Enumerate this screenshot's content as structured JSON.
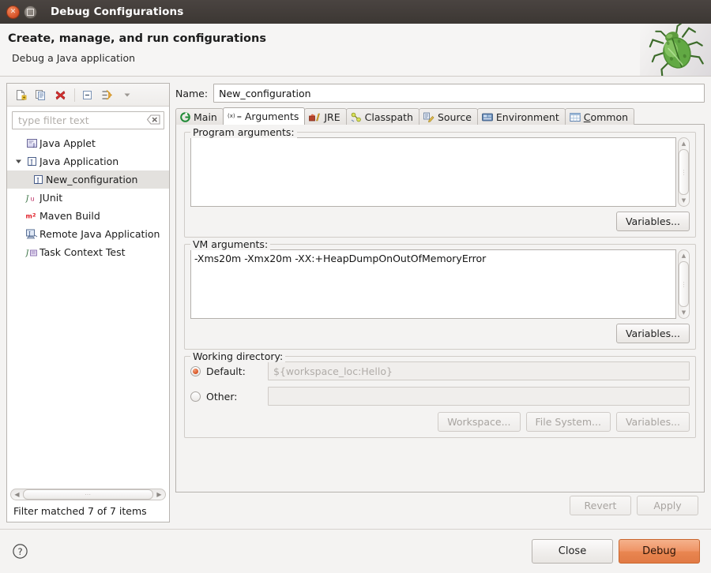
{
  "window": {
    "title": "Debug Configurations",
    "close_icon": "close-icon",
    "maximize_icon": "maximize-icon"
  },
  "header": {
    "title": "Create, manage, and run configurations",
    "subtitle": "Debug a Java application",
    "decoration_icon": "bug-icon"
  },
  "sidebar": {
    "toolbar": [
      {
        "name": "new-configuration-button",
        "icon": "new-document-icon",
        "label": "New launch configuration"
      },
      {
        "name": "duplicate-configuration-button",
        "icon": "duplicate-icon",
        "label": "Duplicate"
      },
      {
        "name": "delete-configuration-button",
        "icon": "delete-x-icon",
        "label": "Delete"
      },
      {
        "name": "collapse-all-button",
        "icon": "collapse-all-icon",
        "label": "Collapse All"
      },
      {
        "name": "filter-button",
        "icon": "filter-icon",
        "label": "Filter"
      },
      {
        "name": "view-menu-button",
        "icon": "chevron-down-icon",
        "label": "View Menu"
      }
    ],
    "filter": {
      "placeholder": "type filter text",
      "value": "",
      "clear_icon": "clear-filter-icon"
    },
    "tree": [
      {
        "label": "Java Applet",
        "icon": "java-applet-icon",
        "indent": 0,
        "expandable": false,
        "selected": false
      },
      {
        "label": "Java Application",
        "icon": "java-application-icon",
        "indent": 0,
        "expandable": true,
        "expanded": true,
        "selected": false
      },
      {
        "label": "New_configuration",
        "icon": "java-application-icon",
        "indent": 1,
        "expandable": false,
        "selected": true
      },
      {
        "label": "JUnit",
        "icon": "junit-icon",
        "indent": 0,
        "expandable": false,
        "selected": false
      },
      {
        "label": "Maven Build",
        "icon": "maven-icon",
        "indent": 0,
        "expandable": false,
        "selected": false
      },
      {
        "label": "Remote Java Application",
        "icon": "remote-java-icon",
        "indent": 0,
        "expandable": false,
        "selected": false
      },
      {
        "label": "Task Context Test",
        "icon": "task-context-icon",
        "indent": 0,
        "expandable": false,
        "selected": false
      }
    ],
    "horizontal_scrollbar": {
      "left_arrow_icon": "scroll-left-icon",
      "right_arrow_icon": "scroll-right-icon",
      "grip": "⋯"
    },
    "status": "Filter matched 7 of 7 items"
  },
  "main": {
    "name_label": "Name:",
    "name_value": "New_configuration",
    "tabs": [
      {
        "label": "Main",
        "icon": "main-tab-icon",
        "active": false
      },
      {
        "label": "Arguments",
        "icon": "arguments-tab-icon",
        "active": true
      },
      {
        "label": "JRE",
        "icon": "jre-tab-icon",
        "active": false
      },
      {
        "label": "Classpath",
        "icon": "classpath-tab-icon",
        "active": false
      },
      {
        "label": "Source",
        "icon": "source-tab-icon",
        "active": false
      },
      {
        "label": "Environment",
        "icon": "environment-tab-icon",
        "active": false
      },
      {
        "label": "Common",
        "icon": "common-tab-icon",
        "active": false,
        "mnemonic": "C"
      }
    ],
    "program_arguments": {
      "group_title": "Program arguments:",
      "value": "",
      "variables_button": "Variables...",
      "scroll_up_icon": "scroll-up-icon",
      "scroll_down_icon": "scroll-down-icon"
    },
    "vm_arguments": {
      "group_title": "VM arguments:",
      "value": "-Xms20m -Xmx20m -XX:+HeapDumpOnOutOfMemoryError",
      "variables_button": "Variables...",
      "scroll_up_icon": "scroll-up-icon",
      "scroll_down_icon": "scroll-down-icon"
    },
    "working_directory": {
      "group_title": "Working directory:",
      "default_label": "Default:",
      "default_value": "${workspace_loc:Hello}",
      "default_selected": true,
      "other_label": "Other:",
      "other_value": "",
      "other_selected": false,
      "buttons": [
        {
          "name": "workspace-button",
          "label": "Workspace...",
          "disabled": true
        },
        {
          "name": "file-system-button",
          "label": "File System...",
          "disabled": true
        },
        {
          "name": "variables-button",
          "label": "Variables...",
          "disabled": true
        }
      ]
    },
    "revert_button": "Revert",
    "apply_button": "Apply"
  },
  "footer": {
    "help_icon": "help-icon",
    "close_button": "Close",
    "debug_button": "Debug"
  },
  "colors": {
    "accent_orange": "#e98651",
    "titlebar": "#403a36",
    "panel_bg": "#f4f3f2",
    "selection": "#e3e1de",
    "delete_red": "#d62f2f"
  }
}
